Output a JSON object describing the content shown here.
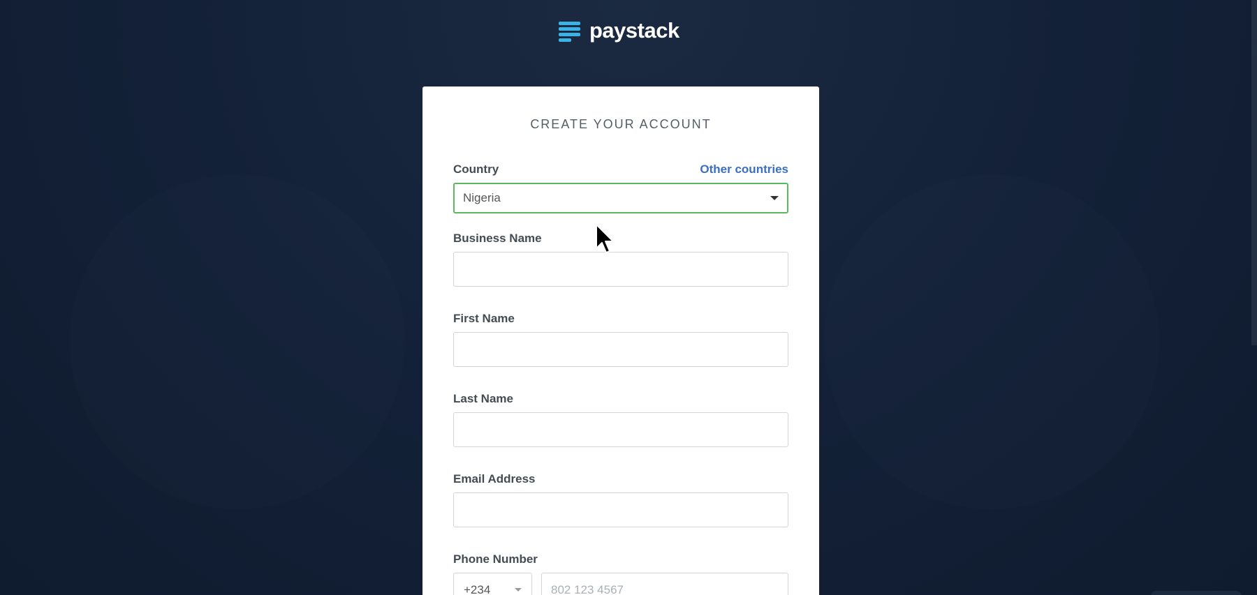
{
  "brand": {
    "name": "paystack",
    "accent": "#3bb3e7",
    "logo_icon": "paystack-logo-icon"
  },
  "form": {
    "title": "CREATE YOUR ACCOUNT",
    "country": {
      "label": "Country",
      "other_link": "Other countries",
      "selected": "Nigeria"
    },
    "business_name": {
      "label": "Business Name",
      "value": ""
    },
    "first_name": {
      "label": "First Name",
      "value": ""
    },
    "last_name": {
      "label": "Last Name",
      "value": ""
    },
    "email": {
      "label": "Email Address",
      "value": ""
    },
    "phone": {
      "label": "Phone Number",
      "code": "+234",
      "placeholder": "802 123 4567",
      "value": ""
    }
  },
  "colors": {
    "background": "#14223a",
    "focus_border": "#5cb85c",
    "link": "#3a6ec4"
  }
}
